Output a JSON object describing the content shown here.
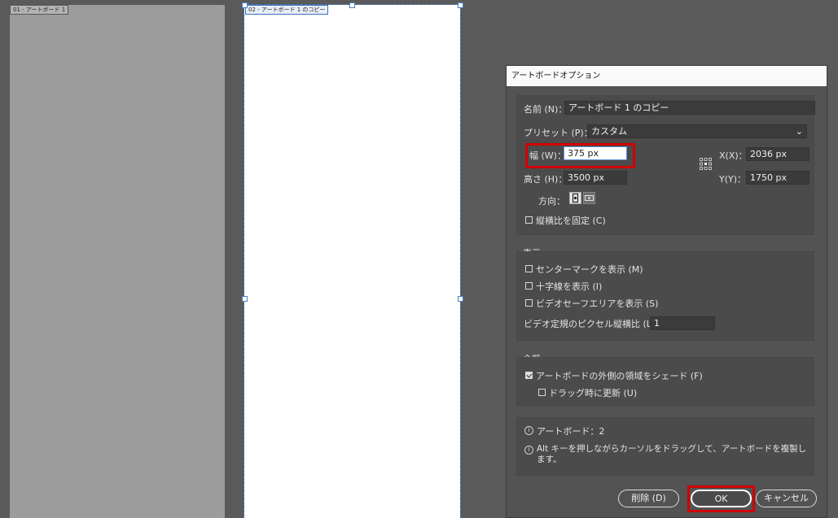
{
  "artboards": [
    {
      "label": "01 - アートボード 1"
    },
    {
      "label": "02 - アートボード 1 のコピー"
    }
  ],
  "dialog": {
    "title": "アートボードオプション",
    "name_label": "名前 (N)：",
    "name_value": "アートボード 1 のコピー",
    "preset_label": "プリセット (P)：",
    "preset_value": "カスタム",
    "width_label": "幅 (W)：",
    "width_value": "375 px",
    "height_label": "高さ (H)：",
    "height_value": "3500 px",
    "x_label": "X(X)：",
    "x_value": "2036 px",
    "y_label": "Y(Y)：",
    "y_value": "1750 px",
    "orientation_label": "方向：",
    "constrain_label": "縦横比を固定 (C)",
    "constrain_checked": false,
    "display_title": "表示",
    "display_options": [
      {
        "label": "センターマークを表示 (M)",
        "checked": false
      },
      {
        "label": "十字線を表示 (I)",
        "checked": false
      },
      {
        "label": "ビデオセーフエリアを表示 (S)",
        "checked": false
      }
    ],
    "pixel_ratio_label": "ビデオ定規のピクセル縦横比 (L)：",
    "pixel_ratio_value": "1",
    "general_title": "全般",
    "shade_label": "アートボードの外側の領域をシェード (F)",
    "shade_checked": true,
    "update_label": "ドラッグ時に更新 (U)",
    "update_checked": false,
    "info_artboards": "アートボード：2",
    "info_hint": "Alt キーを押しながらカーソルをドラッグして、アートボードを複製します。",
    "info_icon_glyph": "i",
    "delete_button": "削除 (D)",
    "ok_button": "OK",
    "cancel_button": "キャンセル",
    "highlight_color": "#d20000"
  }
}
